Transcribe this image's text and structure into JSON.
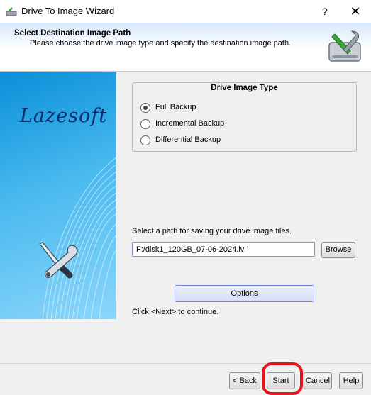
{
  "window": {
    "title": "Drive To Image Wizard",
    "help_glyph": "?",
    "close_glyph": "✕"
  },
  "header": {
    "title": "Select Destination Image Path",
    "subtitle": "Please choose the drive image type and specify the destination image path.",
    "icon": "drive-tools-icon"
  },
  "banner": {
    "brand": "Lazesoft",
    "icon": "screwdriver-wrench-icon"
  },
  "image_type": {
    "title": "Drive Image Type",
    "options": [
      {
        "label": "Full Backup",
        "selected": true
      },
      {
        "label": "Incremental Backup",
        "selected": false
      },
      {
        "label": "Differential Backup",
        "selected": false
      }
    ]
  },
  "path": {
    "label": "Select a path for saving your drive image files.",
    "value": "F:/disk1_120GB_07-06-2024.lvi",
    "browse_label": "Browse"
  },
  "options_label": "Options",
  "hint": "Click <Next> to continue.",
  "footer": {
    "back_label": "< Back",
    "start_label": "Start",
    "cancel_label": "Cancel",
    "help_label": "Help"
  },
  "colors": {
    "annotation": "#e4141a",
    "banner_top": "#0a8fd8",
    "banner_bottom": "#8bd6fb"
  }
}
